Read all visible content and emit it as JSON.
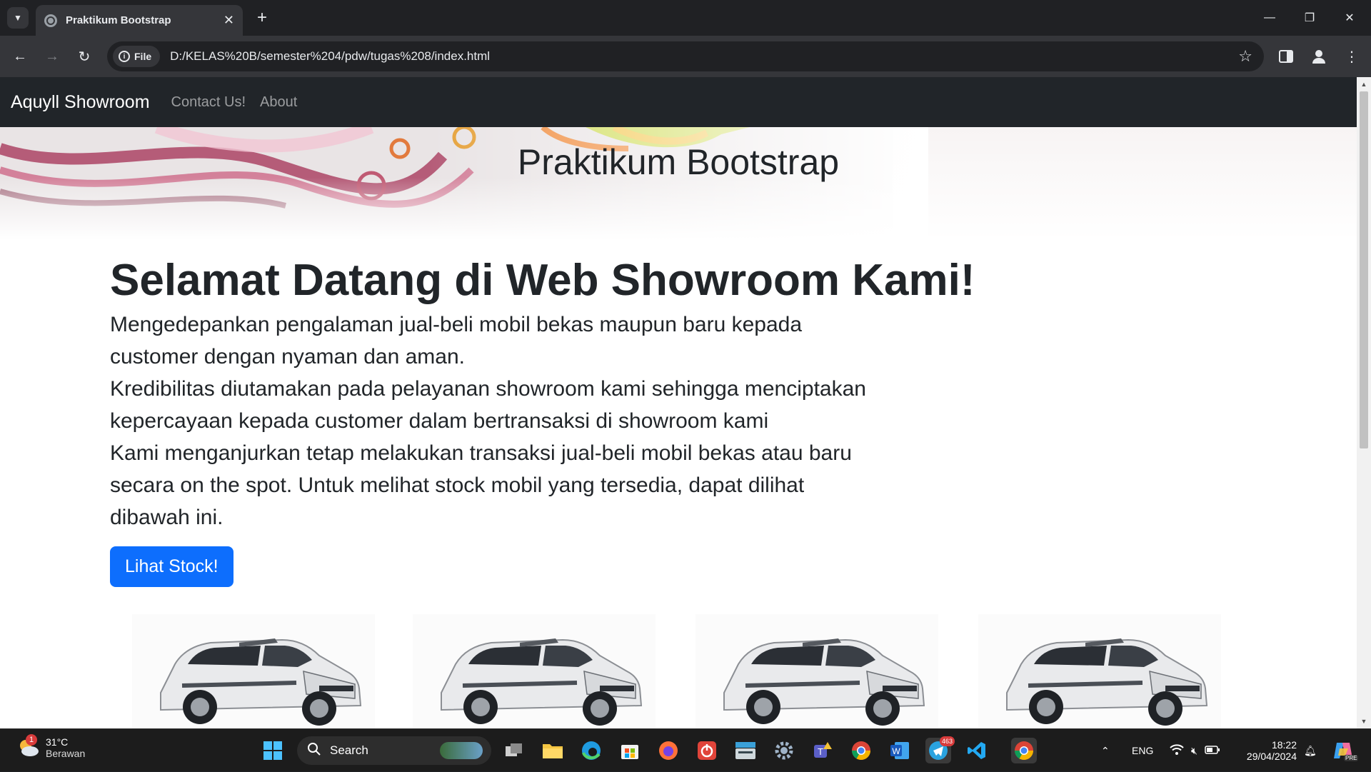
{
  "browser": {
    "tab_title": "Praktikum Bootstrap",
    "url_chip": "File",
    "url": "D:/KELAS%20B/semester%204/pdw/tugas%208/index.html"
  },
  "page": {
    "brand": "Aquyll Showroom",
    "nav_links": [
      "Contact Us!",
      "About"
    ],
    "hero_title": "Praktikum Bootstrap",
    "heading": "Selamat Datang di Web Showroom Kami!",
    "paragraphs": [
      "Mengedepankan pengalaman jual-beli mobil bekas maupun baru kepada customer dengan nyaman dan aman.",
      "Kredibilitas diutamakan pada pelayanan showroom kami sehingga menciptakan kepercayaan kepada customer dalam bertransaksi di showroom kami",
      "Kami menganjurkan tetap melakukan transaksi jual-beli mobil bekas atau baru secara on the spot. Untuk melihat stock mobil yang tersedia, dapat dilihat dibawah ini."
    ],
    "button_label": "Lihat Stock!",
    "car_count": 4,
    "colors": {
      "navbar": "#212529",
      "primary": "#0d6efd"
    }
  },
  "taskbar": {
    "weather_temp": "31°C",
    "weather_desc": "Berawan",
    "weather_badge": "1",
    "search_label": "Search",
    "telegram_badge": "463",
    "language": "ENG",
    "time": "18:22",
    "date": "29/04/2024",
    "copilot_badge": "PRE"
  }
}
